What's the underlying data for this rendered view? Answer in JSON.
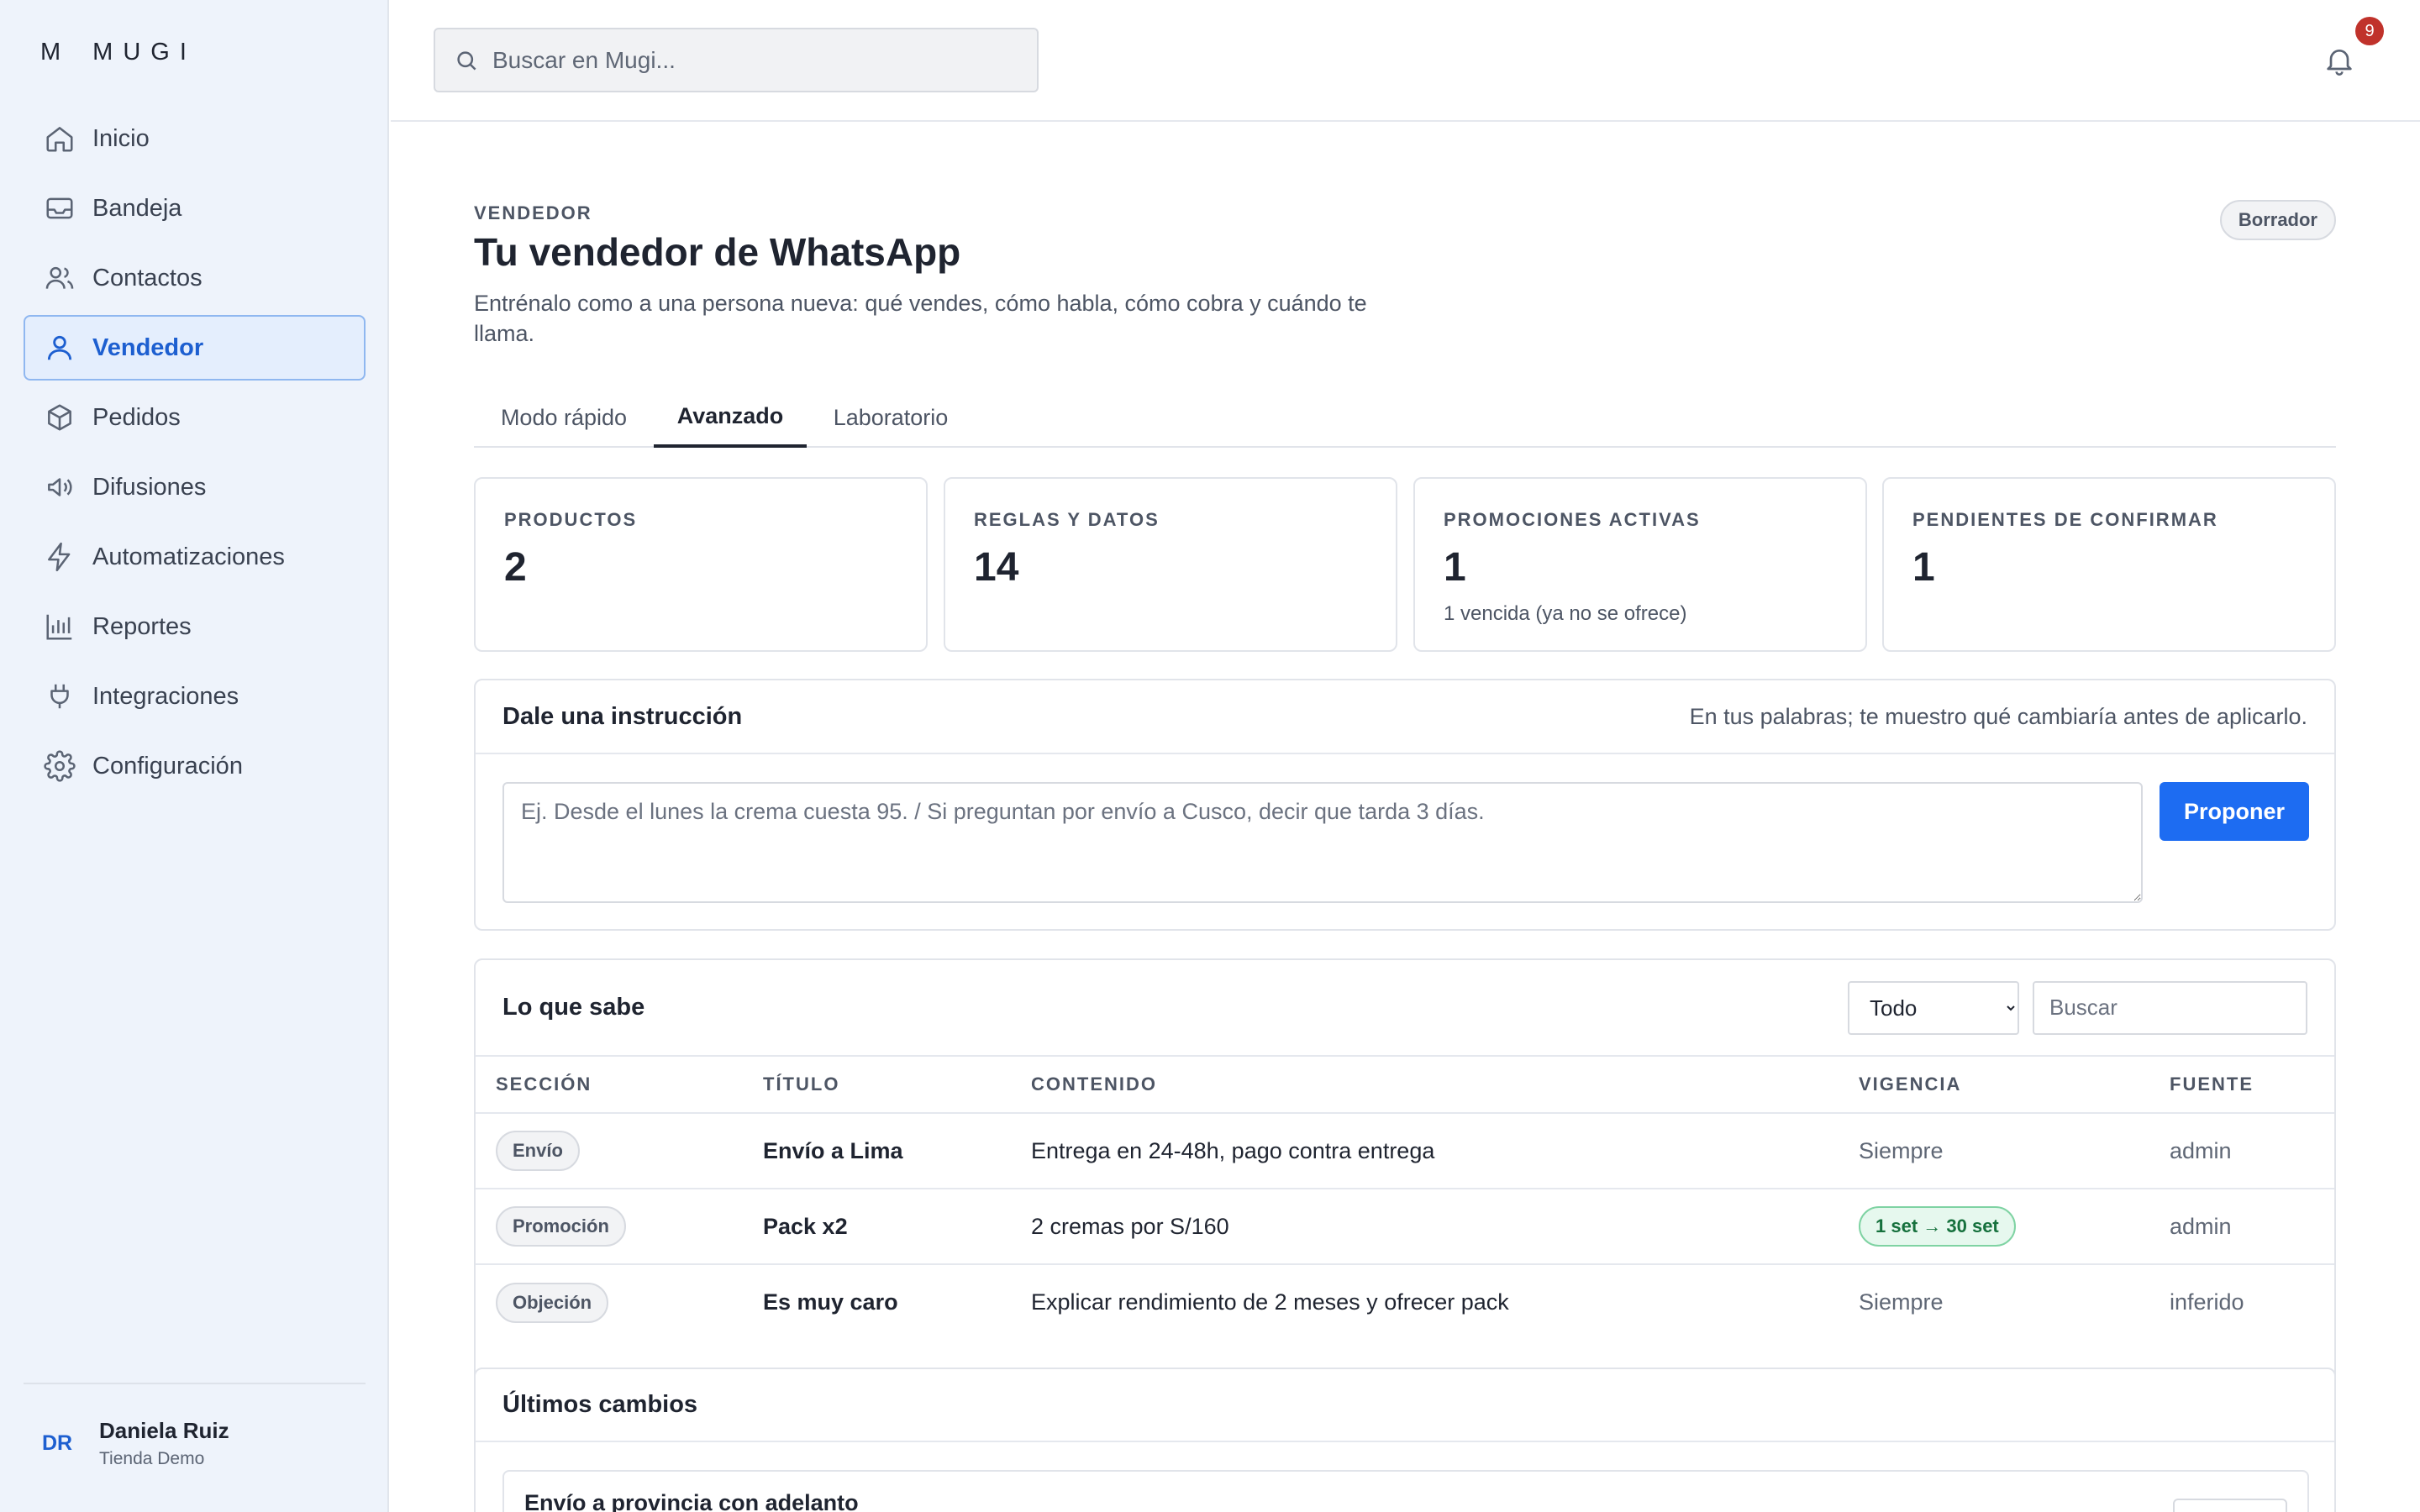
{
  "brand": {
    "mark": "M",
    "name": "MUGI"
  },
  "sidebar": {
    "items": [
      {
        "label": "Inicio",
        "icon": "home-icon"
      },
      {
        "label": "Bandeja",
        "icon": "inbox-icon"
      },
      {
        "label": "Contactos",
        "icon": "users-icon"
      },
      {
        "label": "Vendedor",
        "icon": "user-icon",
        "active": true
      },
      {
        "label": "Pedidos",
        "icon": "box-icon"
      },
      {
        "label": "Difusiones",
        "icon": "megaphone-icon"
      },
      {
        "label": "Automatizaciones",
        "icon": "bolt-icon"
      },
      {
        "label": "Reportes",
        "icon": "bar-chart-icon"
      },
      {
        "label": "Integraciones",
        "icon": "plug-icon"
      },
      {
        "label": "Configuración",
        "icon": "gear-icon"
      }
    ],
    "user": {
      "initials": "DR",
      "name": "Daniela Ruiz",
      "store": "Tienda Demo"
    }
  },
  "topbar": {
    "search_placeholder": "Buscar en Mugi...",
    "notifications_count": "9"
  },
  "page": {
    "eyebrow": "VENDEDOR",
    "title": "Tu vendedor de WhatsApp",
    "subtitle": "Entrénalo como a una persona nueva: qué vendes, cómo habla, cómo cobra y cuándo te llama.",
    "status": "Borrador"
  },
  "tabs": [
    {
      "label": "Modo rápido"
    },
    {
      "label": "Avanzado",
      "active": true
    },
    {
      "label": "Laboratorio"
    }
  ],
  "stats": [
    {
      "label": "PRODUCTOS",
      "value": "2",
      "note": ""
    },
    {
      "label": "REGLAS Y DATOS",
      "value": "14",
      "note": ""
    },
    {
      "label": "PROMOCIONES ACTIVAS",
      "value": "1",
      "note": "1 vencida (ya no se ofrece)"
    },
    {
      "label": "PENDIENTES DE CONFIRMAR",
      "value": "1",
      "note": ""
    }
  ],
  "instruction": {
    "title": "Dale una instrucción",
    "hint": "En tus palabras; te muestro qué cambiaría antes de aplicarlo.",
    "placeholder": "Ej. Desde el lunes la crema cuesta 95. / Si preguntan por envío a Cusco, decir que tarda 3 días.",
    "button": "Proponer"
  },
  "knowledge": {
    "title": "Lo que sabe",
    "filter_selected": "Todo",
    "search_placeholder": "Buscar",
    "columns": [
      "SECCIÓN",
      "TÍTULO",
      "CONTENIDO",
      "VIGENCIA",
      "FUENTE"
    ],
    "rows": [
      {
        "section": "Envío",
        "title": "Envío a Lima",
        "content": "Entrega en 24-48h, pago contra entrega",
        "validity": "Siempre",
        "validity_type": "plain",
        "source": "admin"
      },
      {
        "section": "Promoción",
        "title": "Pack x2",
        "content": "2 cremas por S/160",
        "validity": "1 set → 30 set",
        "validity_type": "range",
        "source": "admin"
      },
      {
        "section": "Objeción",
        "title": "Es muy caro",
        "content": "Explicar rendimiento de 2 meses y ofrecer pack",
        "validity": "Siempre",
        "validity_type": "plain",
        "source": "inferido"
      }
    ]
  },
  "changes": {
    "title": "Últimos cambios",
    "items": [
      {
        "title": "Envío a provincia con adelanto"
      }
    ]
  },
  "colors": {
    "accent": "#1d6cf2",
    "active_nav": "#1d5fd0",
    "badge": "#c0322b",
    "success": "#16713d"
  }
}
